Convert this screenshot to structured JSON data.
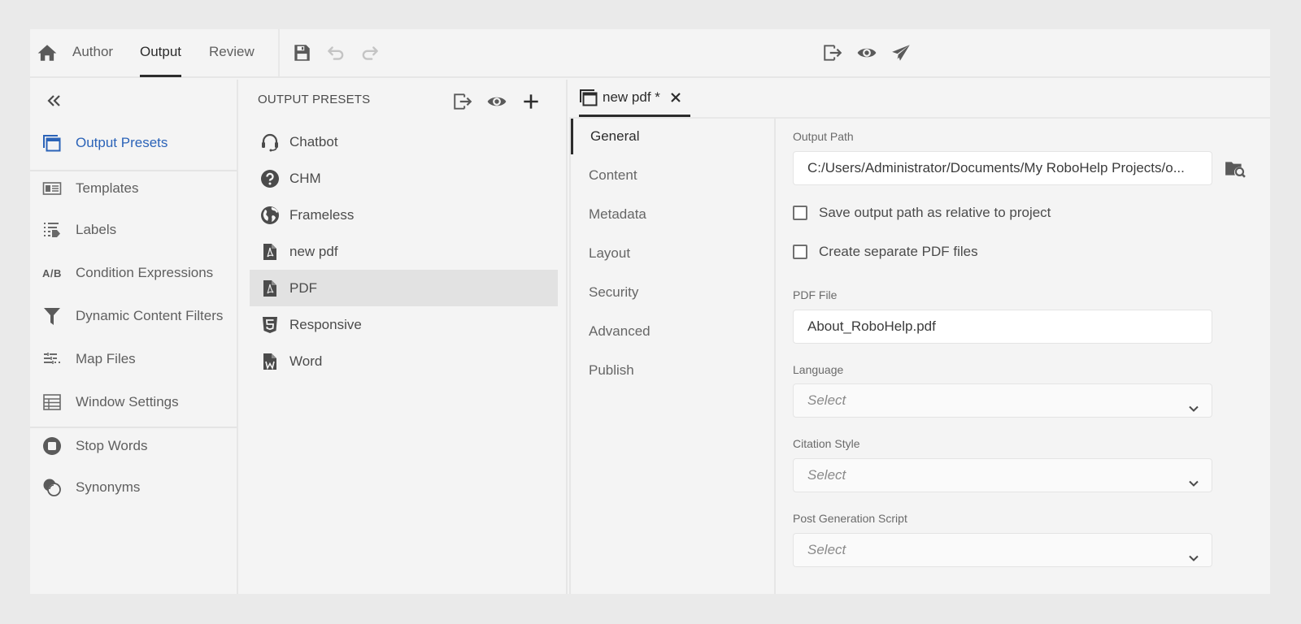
{
  "topbar": {
    "tabs": [
      {
        "label": "Author",
        "active": false
      },
      {
        "label": "Output",
        "active": true
      },
      {
        "label": "Review",
        "active": false
      }
    ],
    "left_icons": [
      "home-icon",
      "save-icon",
      "undo-icon",
      "redo-icon"
    ],
    "right_icons": [
      "generate-icon",
      "preview-icon",
      "publish-icon"
    ]
  },
  "sidebar": {
    "collapse_icon": "double-chevron-left-icon",
    "items": [
      {
        "label": "Output Presets",
        "icon": "output-presets-icon",
        "active": true
      },
      {
        "label": "Templates",
        "icon": "templates-icon"
      },
      {
        "label": "Labels",
        "icon": "labels-icon"
      },
      {
        "label": "Condition Expressions",
        "icon": "ab-icon",
        "icon_text": "A/B"
      },
      {
        "label": "Dynamic Content Filters",
        "icon": "filter-icon"
      },
      {
        "label": "Map Files",
        "icon": "map-files-icon"
      },
      {
        "label": "Window Settings",
        "icon": "window-settings-icon"
      },
      {
        "label": "Stop Words",
        "icon": "stop-icon"
      },
      {
        "label": "Synonyms",
        "icon": "synonyms-icon"
      }
    ]
  },
  "presets": {
    "title": "OUTPUT PRESETS",
    "header_icons": [
      "generate-icon",
      "preview-icon",
      "add-icon"
    ],
    "items": [
      {
        "label": "Chatbot",
        "icon": "headset-icon"
      },
      {
        "label": "CHM",
        "icon": "help-icon"
      },
      {
        "label": "Frameless",
        "icon": "globe-icon"
      },
      {
        "label": "new pdf",
        "icon": "pdf-icon"
      },
      {
        "label": "PDF",
        "icon": "pdf-icon",
        "selected": true
      },
      {
        "label": "Responsive",
        "icon": "html5-icon"
      },
      {
        "label": "Word",
        "icon": "word-icon"
      }
    ]
  },
  "editor": {
    "tab": {
      "label": "new pdf *",
      "icon": "output-presets-icon",
      "close_icon": "close-icon"
    },
    "nav": [
      {
        "label": "General",
        "active": true
      },
      {
        "label": "Content"
      },
      {
        "label": "Metadata"
      },
      {
        "label": "Layout"
      },
      {
        "label": "Security"
      },
      {
        "label": "Advanced"
      },
      {
        "label": "Publish"
      }
    ],
    "form": {
      "output_path_label": "Output Path",
      "output_path_value": "C:/Users/Administrator/Documents/My RoboHelp Projects/o...",
      "browse_icon": "browse-folder-icon",
      "checkbox_relative": {
        "label": "Save output path as relative to project",
        "checked": false
      },
      "checkbox_separate": {
        "label": "Create separate PDF files",
        "checked": false
      },
      "pdf_file_label": "PDF File",
      "pdf_file_value": "About_RoboHelp.pdf",
      "language_label": "Language",
      "language_value": "Select",
      "citation_label": "Citation Style",
      "citation_value": "Select",
      "postgen_label": "Post Generation Script",
      "postgen_value": "Select"
    }
  }
}
